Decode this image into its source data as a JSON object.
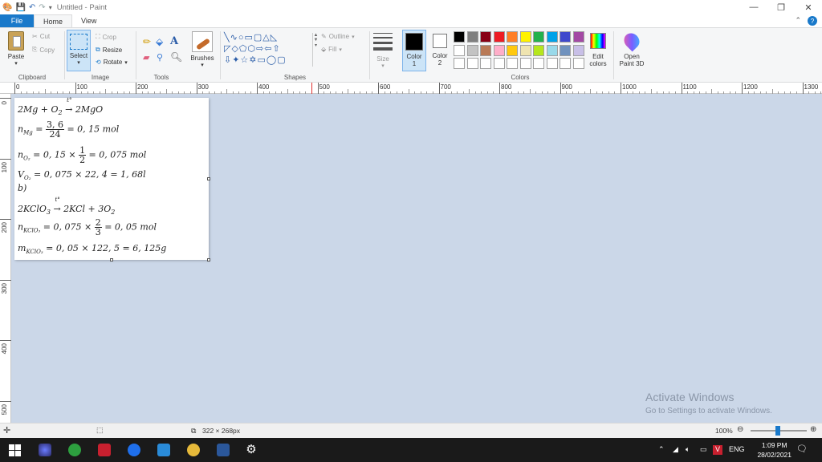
{
  "window": {
    "title": "Untitled - Paint",
    "controls": {
      "minimize": "—",
      "restore": "❐",
      "close": "✕"
    }
  },
  "tabs": {
    "file": "File",
    "home": "Home",
    "view": "View"
  },
  "ribbon": {
    "clipboard": {
      "label": "Clipboard",
      "paste": "Paste",
      "cut": "Cut",
      "copy": "Copy"
    },
    "image": {
      "label": "Image",
      "select": "Select",
      "crop": "Crop",
      "resize": "Resize",
      "rotate": "Rotate"
    },
    "tools": {
      "label": "Tools"
    },
    "brushes": {
      "label": "Brushes"
    },
    "shapes": {
      "label": "Shapes",
      "outline": "Outline",
      "fill": "Fill"
    },
    "size": {
      "label": "Size"
    },
    "color1": {
      "label": "Color",
      "sub": "1"
    },
    "color2": {
      "label": "Color",
      "sub": "2"
    },
    "colors": {
      "label": "Colors",
      "edit": "Edit",
      "edit2": "colors"
    },
    "paint3d": {
      "label": "Open",
      "label2": "Paint 3D"
    },
    "palette_row1": [
      "#000000",
      "#7f7f7f",
      "#880015",
      "#ed1c24",
      "#ff7f27",
      "#fff200",
      "#22b14c",
      "#00a2e8",
      "#3f48cc",
      "#a349a4"
    ],
    "palette_row2": [
      "#ffffff",
      "#c3c3c3",
      "#b97a57",
      "#ffaec9",
      "#ffc90e",
      "#efe4b0",
      "#b5e61d",
      "#99d9ea",
      "#7092be",
      "#c8bfe7"
    ],
    "palette_row3": [
      "#ffffff",
      "#ffffff",
      "#ffffff",
      "#ffffff",
      "#ffffff",
      "#ffffff",
      "#ffffff",
      "#ffffff",
      "#ffffff",
      "#ffffff"
    ]
  },
  "ruler": {
    "top": [
      "0",
      "100",
      "200",
      "300",
      "400",
      "500",
      "600",
      "700",
      "800",
      "900",
      "1000",
      "1100",
      "1200",
      "1300"
    ],
    "left": [
      "0",
      "100",
      "200",
      "300",
      "400",
      "500"
    ]
  },
  "canvas": {
    "lines": [
      {
        "text": "2Mg + O₂ →ᵗ° 2MgO"
      },
      {
        "pre": "n",
        "sub": "Mg",
        "eq": " = ",
        "num": "3, 6",
        "den": "24",
        "post": " = 0, 15 mol"
      },
      {
        "pre": "n",
        "sub": "O₂",
        "eq": " = 0, 15 × ",
        "num": "1",
        "den": "2",
        "post": " = 0, 075 mol"
      },
      {
        "text": "V_O₂ = 0, 075 × 22, 4 = 1, 68l"
      },
      {
        "text": "b)"
      },
      {
        "text": "2KClO₃ →ᵗ° 2KCl + 3O₂"
      },
      {
        "pre": "n",
        "sub": "KClO₃",
        "eq": " = 0, 075 × ",
        "num": "2",
        "den": "3",
        "post": " = 0, 05 mol"
      },
      {
        "text": "m_KClO₃ = 0, 05 × 122, 5 = 6, 125g"
      }
    ]
  },
  "watermark": {
    "title": "Activate Windows",
    "subtitle": "Go to Settings to activate Windows."
  },
  "status": {
    "size": "322 × 268px",
    "zoom": "100%"
  },
  "taskbar": {
    "lang": "ENG",
    "time": "1:09 PM",
    "date": "28/02/2021"
  }
}
